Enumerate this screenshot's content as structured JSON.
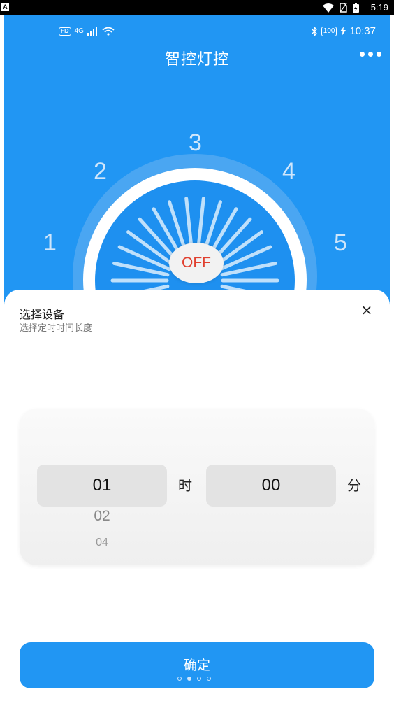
{
  "system_bar": {
    "badge": "A",
    "time": "5:19"
  },
  "phone_status": {
    "hd": "HD",
    "network": "4G",
    "battery": "100",
    "time": "10:37"
  },
  "app": {
    "title": "智控灯控"
  },
  "dial": {
    "numbers": [
      "1",
      "2",
      "3",
      "4",
      "5"
    ],
    "state_label": "OFF"
  },
  "sheet": {
    "title": "选择设备",
    "subtitle": "选择定时时间长度",
    "close_symbol": "×",
    "hour": {
      "selected": "01",
      "next": "02",
      "next2": "04",
      "unit": "时"
    },
    "minute": {
      "selected": "00",
      "unit": "分"
    },
    "confirm_label": "确定",
    "page_count": 4,
    "page_active": 2
  },
  "colors": {
    "primary": "#2196f3",
    "off_text": "#e0402f"
  }
}
